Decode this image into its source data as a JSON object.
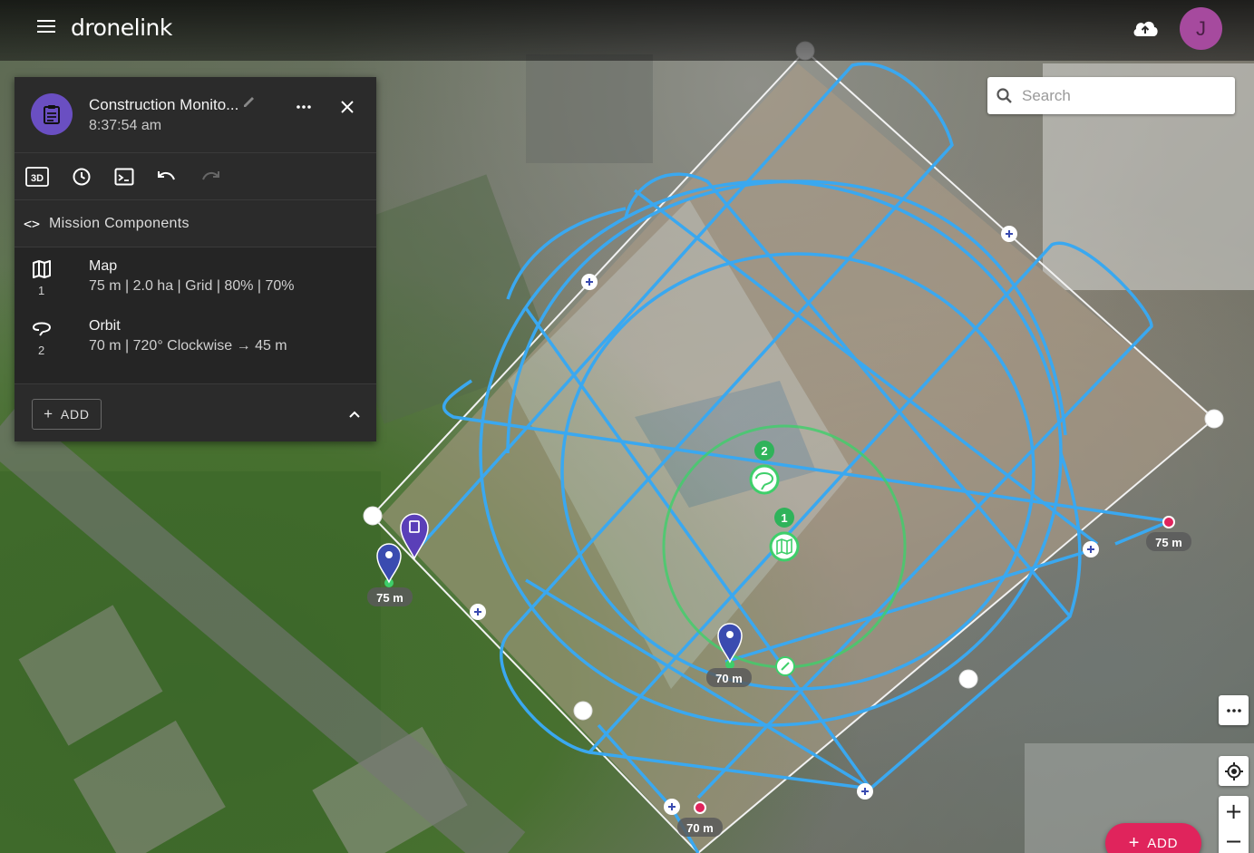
{
  "app": {
    "logo": "dronelink",
    "avatar_initial": "J"
  },
  "search": {
    "placeholder": "Search"
  },
  "mission": {
    "title": "Construction Monito...",
    "time": "8:37:54 am",
    "components_label": "Mission Components",
    "components": [
      {
        "title": "Map",
        "number": "1",
        "description": "75 m | 2.0 ha | Grid | 80% | 70%",
        "icon": "map-icon"
      },
      {
        "title": "Orbit",
        "number": "2",
        "description": "70 m | 720° Clockwise → 45 m",
        "icon": "orbit-icon"
      }
    ],
    "add_label": "ADD"
  },
  "map_labels": {
    "start_altitude": "75 m",
    "right_altitude": "75 m",
    "orbit_altitude": "70 m",
    "bottom_altitude": "70 m",
    "marker_1": "1",
    "marker_2": "2"
  },
  "fab": {
    "add_label": "ADD"
  },
  "colors": {
    "route": "#3aa8f0",
    "orbit_ring": "#3ecf6a",
    "accent_fab": "#e0245c",
    "mission_icon": "#6a4fc2",
    "avatar": "#a64a9e",
    "waypoint_marker": "#3a4bb0"
  }
}
